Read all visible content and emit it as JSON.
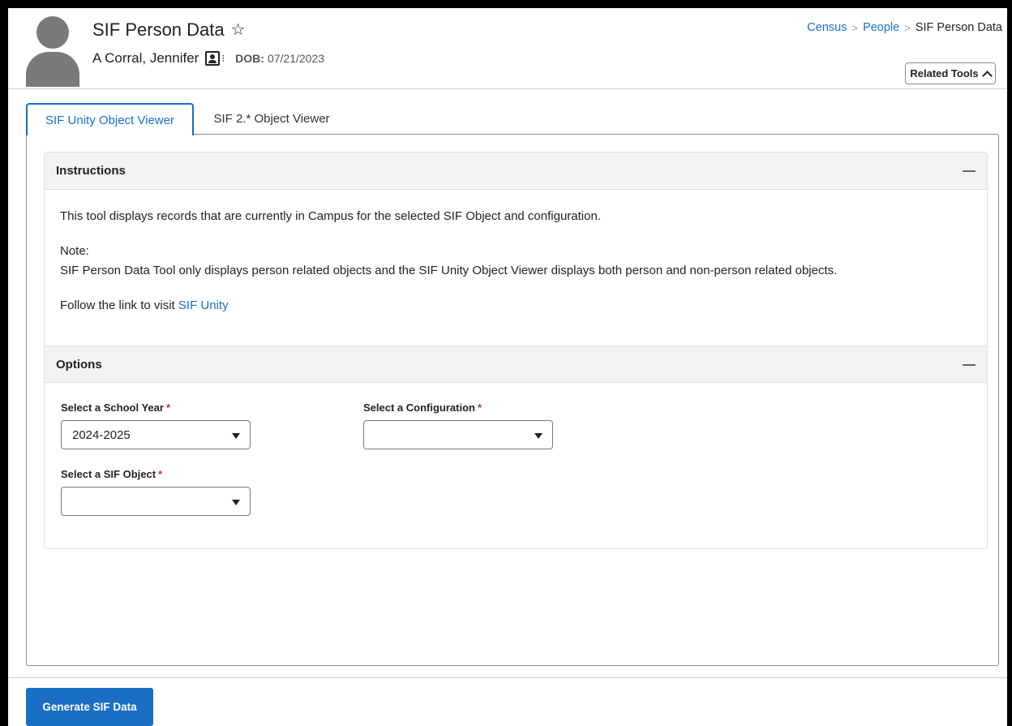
{
  "header": {
    "page_title": "SIF Person Data",
    "person_name": "A Corral, Jennifer",
    "dob_label": "DOB:",
    "dob_value": "07/21/2023",
    "breadcrumb": [
      {
        "label": "Census",
        "link": true
      },
      {
        "label": "People",
        "link": true
      },
      {
        "label": "SIF Person Data",
        "link": false
      }
    ],
    "breadcrumb_sep": ">",
    "related_tools_label": "Related Tools"
  },
  "tabs": [
    {
      "label": "SIF Unity Object Viewer",
      "active": true
    },
    {
      "label": "SIF 2.* Object Viewer",
      "active": false
    }
  ],
  "instructions": {
    "title": "Instructions",
    "line1": "This tool displays records that are currently in Campus for the selected SIF Object and configuration.",
    "note_label": "Note:",
    "note_text": "SIF Person Data Tool only displays person related objects and the SIF Unity Object Viewer displays both person and non-person related objects.",
    "follow_text": "Follow the link to visit ",
    "link_text": "SIF Unity"
  },
  "options": {
    "title": "Options",
    "school_year_label": "Select a School Year",
    "school_year_value": "2024-2025",
    "configuration_label": "Select a Configuration",
    "configuration_value": "",
    "sif_object_label": "Select a SIF Object",
    "sif_object_value": "",
    "required_mark": "*"
  },
  "footer": {
    "generate_label": "Generate SIF Data"
  },
  "colors": {
    "accent": "#1a6fc4",
    "required": "#d62d20"
  }
}
